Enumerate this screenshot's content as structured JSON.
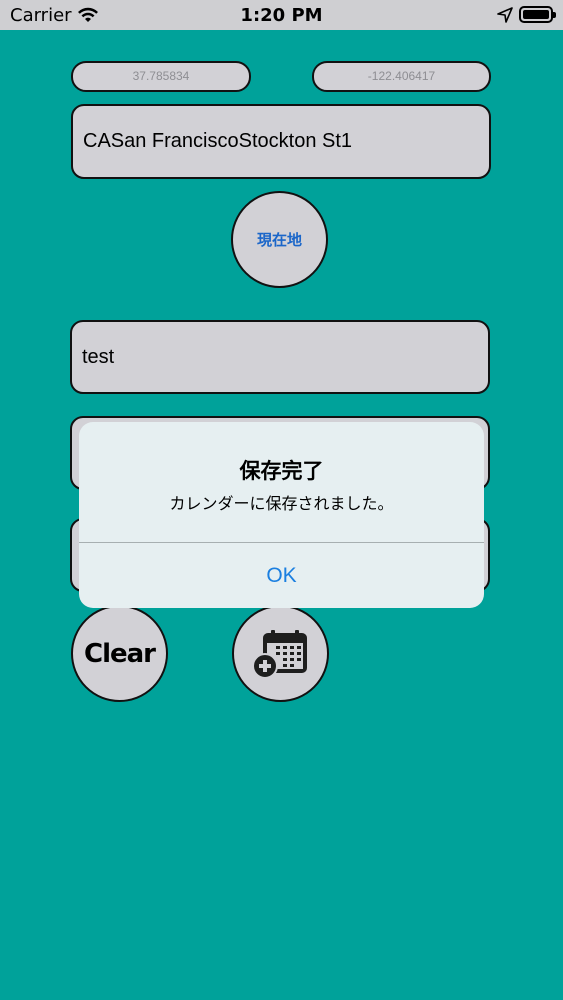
{
  "status_bar": {
    "carrier": "Carrier",
    "time": "1:20 PM",
    "wifi_icon": "wifi-icon",
    "location_icon": "location-arrow-icon",
    "battery_icon": "battery-icon"
  },
  "coords": {
    "latitude": "37.785834",
    "longitude": "-122.406417"
  },
  "address": "CASan FranciscoStockton St1",
  "current_location_button": "現在地",
  "title_field": "test",
  "field2": "",
  "field3": "",
  "clear_button": "Clear",
  "add_calendar_icon": "calendar-add-icon",
  "alert": {
    "title": "保存完了",
    "message": "カレンダーに保存されました。",
    "ok": "OK"
  },
  "colors": {
    "background": "#00A29A",
    "field": "#D2D1D6",
    "accent": "#1B7FE0"
  }
}
